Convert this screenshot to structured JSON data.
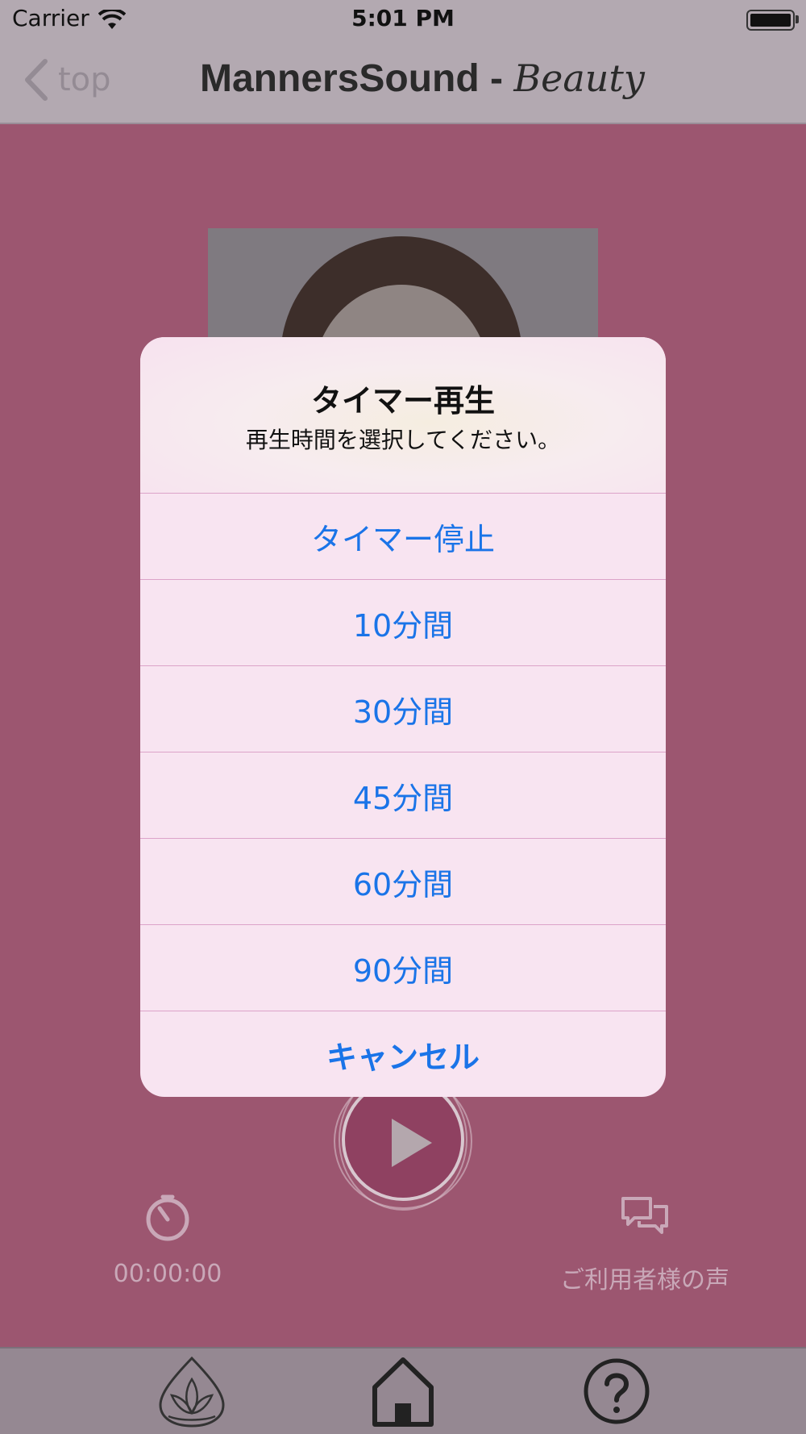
{
  "status_bar": {
    "carrier": "Carrier",
    "time": "5:01 PM"
  },
  "nav": {
    "back_label": "top",
    "title_main": "MannersSound - ",
    "title_script": "Beauty"
  },
  "player": {
    "timer_value": "00:00:00",
    "voices_label": "ご利用者様の声"
  },
  "alert": {
    "title": "タイマー再生",
    "message": "再生時間を選択してください。",
    "actions": [
      "タイマー停止",
      "10分間",
      "30分間",
      "45分間",
      "60分間",
      "90分間"
    ],
    "cancel": "キャンセル"
  },
  "tabs": [
    {
      "icon": "lotus-icon"
    },
    {
      "icon": "home-icon"
    },
    {
      "icon": "help-icon"
    }
  ],
  "colors": {
    "background": "#9c5670",
    "action_text": "#1a74e8",
    "dialog_bg": "#f8e4f1"
  }
}
